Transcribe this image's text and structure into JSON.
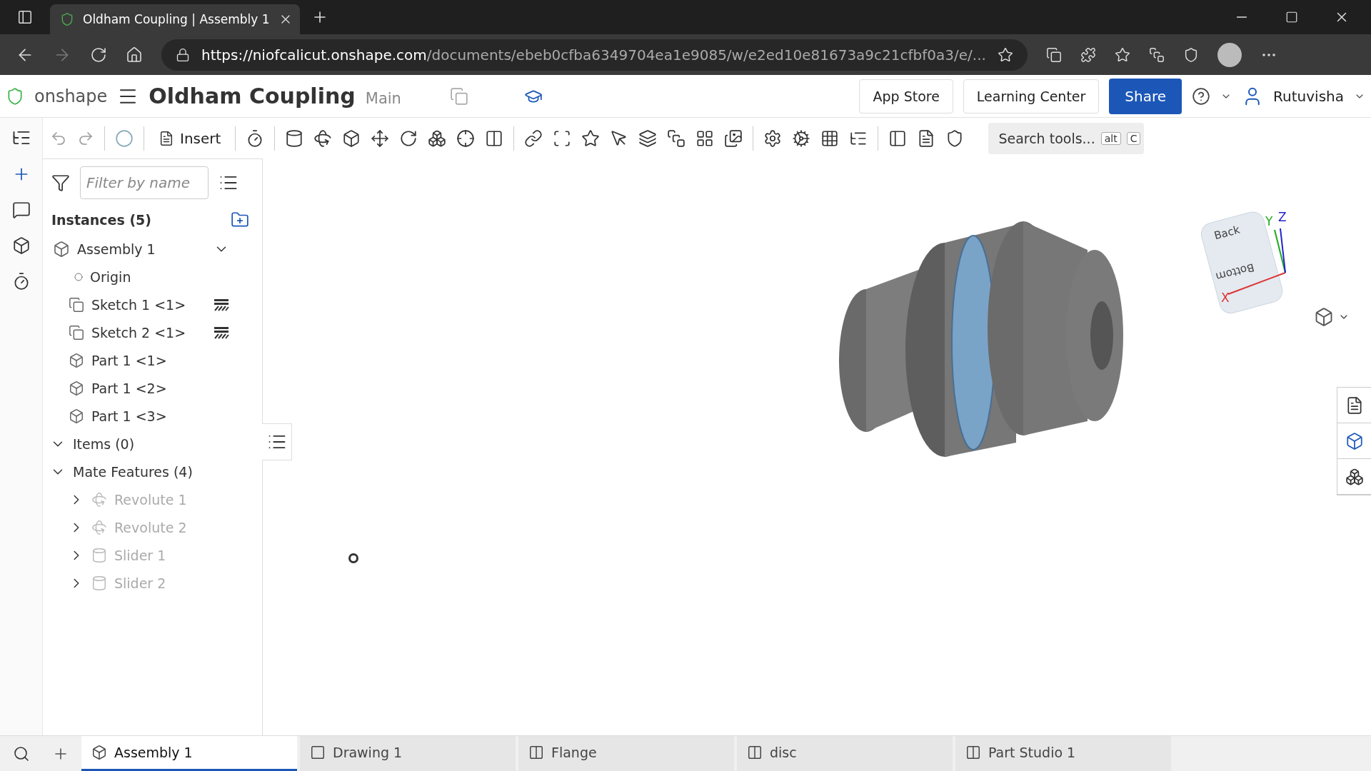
{
  "browser": {
    "tabs": [
      {
        "title": "Oldham Coupling | Assembly 1",
        "selected": true
      }
    ],
    "url": {
      "host": "https://niofcalicut.onshape.com",
      "path": "/documents/ebeb0cfba6349704ea1e9085/w/e2ed10e81673a9c21cfbf0a3/e/..."
    }
  },
  "header": {
    "logo": "onshape",
    "title": "Oldham Coupling",
    "branch": "Main",
    "buttons": [
      "App Store",
      "Learning Center"
    ],
    "share": "Share",
    "user": "Rutuvisha"
  },
  "toolbar": {
    "insert": "Insert",
    "search": {
      "placeholder": "Search tools...",
      "keys": [
        "alt",
        "C"
      ]
    }
  },
  "panel": {
    "filter": {
      "placeholder": "Filter by name"
    },
    "instances_title": "Instances (5)",
    "instances": [
      {
        "label": "Assembly 1",
        "kind": "assembly",
        "fixed": false
      },
      {
        "label": "Origin",
        "kind": "origin",
        "fixed": false
      },
      {
        "label": "Sketch 1 <1>",
        "kind": "sketch",
        "fixed": true
      },
      {
        "label": "Sketch 2 <1>",
        "kind": "sketch",
        "fixed": true
      },
      {
        "label": "Part 1 <1>",
        "kind": "part",
        "fixed": false
      },
      {
        "label": "Part 1 <2>",
        "kind": "part",
        "fixed": false
      },
      {
        "label": "Part 1 <3>",
        "kind": "part",
        "fixed": false
      }
    ],
    "groups": [
      {
        "label": "Items (0)",
        "expanded": true
      },
      {
        "label": "Mate Features (4)",
        "expanded": true,
        "children": [
          {
            "label": "Revolute 1",
            "kind": "revolute",
            "disabled": true
          },
          {
            "label": "Revolute 2",
            "kind": "revolute",
            "disabled": true
          },
          {
            "label": "Slider 1",
            "kind": "slider",
            "disabled": true
          },
          {
            "label": "Slider 2",
            "kind": "slider",
            "disabled": true
          }
        ]
      }
    ]
  },
  "viewcube": {
    "faces": [
      "Back",
      "Bottom"
    ],
    "axes": [
      "X",
      "Y",
      "Z"
    ]
  },
  "tabs": [
    {
      "label": "Assembly 1",
      "kind": "assembly",
      "selected": true
    },
    {
      "label": "Drawing 1",
      "kind": "drawing",
      "selected": false
    },
    {
      "label": "Flange",
      "kind": "partstudio",
      "selected": false
    },
    {
      "label": "disc",
      "kind": "partstudio",
      "selected": false
    },
    {
      "label": "Part Studio 1",
      "kind": "partstudio",
      "selected": false
    }
  ]
}
